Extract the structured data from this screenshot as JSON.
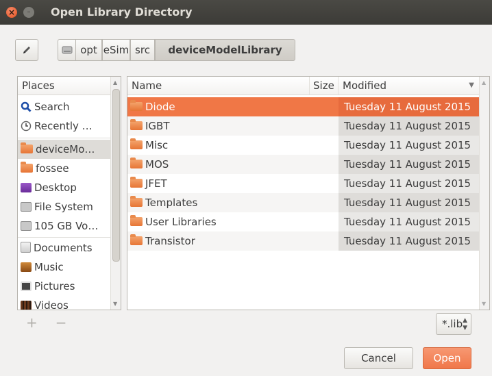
{
  "window": {
    "title": "Open Library Directory"
  },
  "pathbar": {
    "segments": [
      "opt",
      "eSim",
      "src",
      "deviceModelLibrary"
    ]
  },
  "places": {
    "header": "Places",
    "items": [
      {
        "label": "Search",
        "icon": "search-icon",
        "color": "#1f4fa8"
      },
      {
        "label": "Recently …",
        "icon": "clock-icon",
        "color": "#666666"
      },
      {
        "label": "deviceMo…",
        "icon": "folder-icon",
        "color": "#e77535",
        "selected": true
      },
      {
        "label": "fossee",
        "icon": "home-folder-icon",
        "color": "#e77535"
      },
      {
        "label": "Desktop",
        "icon": "desktop-icon",
        "color": "#7a3aa8"
      },
      {
        "label": "File System",
        "icon": "drive-icon",
        "color": "#9a9a9a"
      },
      {
        "label": "105 GB Vo…",
        "icon": "drive-icon",
        "color": "#9a9a9a"
      },
      {
        "label": "Documents",
        "icon": "documents-icon",
        "color": "#e77535"
      },
      {
        "label": "Music",
        "icon": "music-icon",
        "color": "#b5651d"
      },
      {
        "label": "Pictures",
        "icon": "pictures-icon",
        "color": "#555555"
      },
      {
        "label": "Videos",
        "icon": "videos-icon",
        "color": "#6b3a1e"
      }
    ],
    "add_label": "+",
    "remove_label": "−"
  },
  "files": {
    "columns": {
      "name": "Name",
      "size": "Size",
      "modified": "Modified"
    },
    "rows": [
      {
        "name": "Diode",
        "size": "",
        "modified": "Tuesday 11 August 2015",
        "selected": true
      },
      {
        "name": "IGBT",
        "size": "",
        "modified": "Tuesday 11 August 2015"
      },
      {
        "name": "Misc",
        "size": "",
        "modified": "Tuesday 11 August 2015"
      },
      {
        "name": "MOS",
        "size": "",
        "modified": "Tuesday 11 August 2015"
      },
      {
        "name": "JFET",
        "size": "",
        "modified": "Tuesday 11 August 2015"
      },
      {
        "name": "Templates",
        "size": "",
        "modified": "Tuesday 11 August 2015"
      },
      {
        "name": "User Libraries",
        "size": "",
        "modified": "Tuesday 11 August 2015"
      },
      {
        "name": "Transistor",
        "size": "",
        "modified": "Tuesday 11 August 2015"
      }
    ]
  },
  "filter": {
    "value": "*.lib"
  },
  "buttons": {
    "cancel": "Cancel",
    "open": "Open"
  },
  "colors": {
    "accent": "#f07746",
    "titlebar": "#3c3b37"
  }
}
